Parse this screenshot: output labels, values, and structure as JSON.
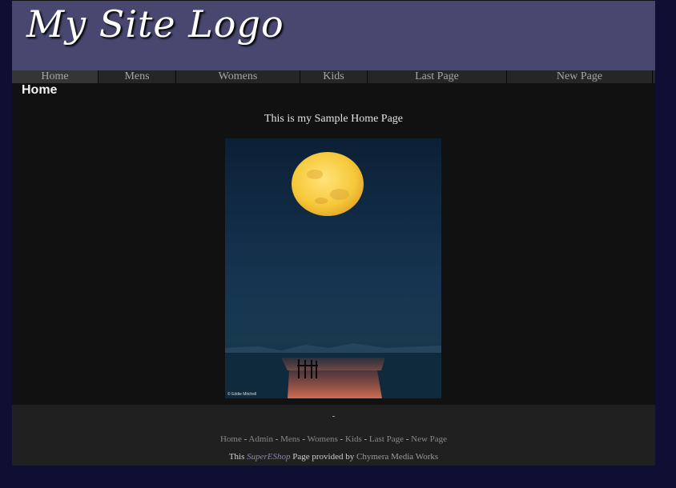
{
  "header": {
    "logo_text": "My Site Logo"
  },
  "nav": {
    "items": [
      {
        "label": "Home"
      },
      {
        "label": "Mens"
      },
      {
        "label": "Womens"
      },
      {
        "label": "Kids"
      },
      {
        "label": "Last Page"
      },
      {
        "label": "New Page"
      }
    ]
  },
  "main": {
    "heading": "Home",
    "intro": "This is my Sample Home Page",
    "image": {
      "credit": "© Eddie Mitchell",
      "subject": "full moon over the sea"
    }
  },
  "footer": {
    "dash": "-",
    "links": [
      "Home",
      "Admin",
      "Mens",
      "Womens",
      "Kids",
      "Last Page",
      "New Page"
    ],
    "separator": " - ",
    "credit_prefix": "This",
    "brand": "SuperEShop",
    "credit_middle": "Page provided by",
    "company": "Chymera Media Works"
  },
  "colors": {
    "background": "#0f0f33",
    "header": "#474770",
    "content": "#111111",
    "nav": "#262626",
    "footer": "#202020",
    "brand": "#8787b0"
  }
}
